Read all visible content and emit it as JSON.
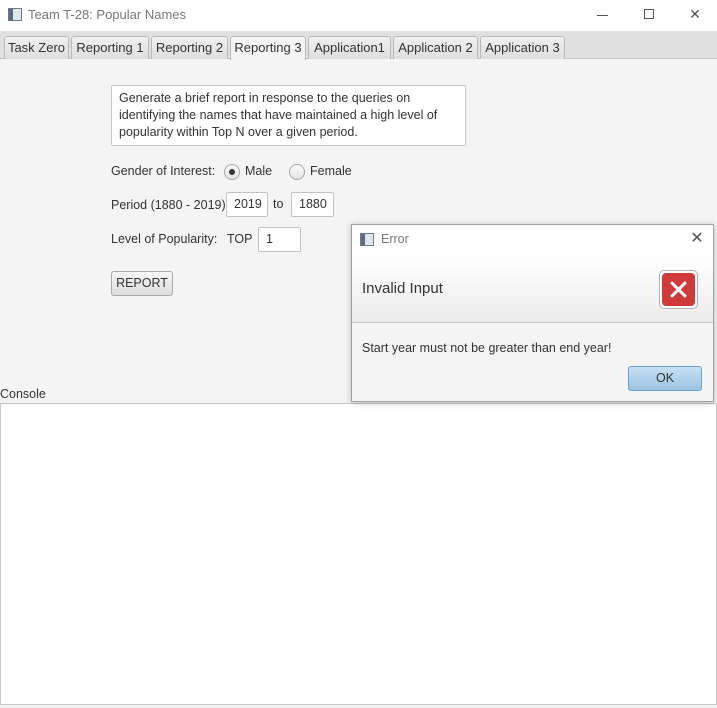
{
  "window": {
    "title": "Team T-28: Popular Names",
    "minimize_icon": "minimize-icon",
    "maximize_icon": "maximize-icon",
    "close_icon": "close-icon"
  },
  "tabs": [
    {
      "label": "Task Zero",
      "active": false
    },
    {
      "label": "Reporting 1",
      "active": false
    },
    {
      "label": "Reporting 2",
      "active": false
    },
    {
      "label": "Reporting 3",
      "active": true
    },
    {
      "label": "Application1",
      "active": false
    },
    {
      "label": "Application 2",
      "active": false
    },
    {
      "label": "Application 3",
      "active": false
    }
  ],
  "form": {
    "description": "Generate a brief report in response to the queries on identifying the names that have maintained a high level of popularity within Top N over a given period.",
    "gender_label": "Gender of Interest:",
    "gender_options": [
      {
        "label": "Male",
        "selected": true
      },
      {
        "label": "Female",
        "selected": false
      }
    ],
    "period_label": "Period (1880 - 2019)",
    "period_start": "2019",
    "period_to": "to",
    "period_end": "1880",
    "popularity_label": "Level of Popularity:",
    "top_label": "TOP",
    "top_value": "1",
    "report_button": "REPORT"
  },
  "console": {
    "label": "Console",
    "content": ""
  },
  "dialog": {
    "title": "Error",
    "header": "Invalid Input",
    "message": "Start year must not be greater than end year!",
    "ok_button": "OK",
    "icon": "error-icon",
    "accent_color": "#d13a3a"
  }
}
